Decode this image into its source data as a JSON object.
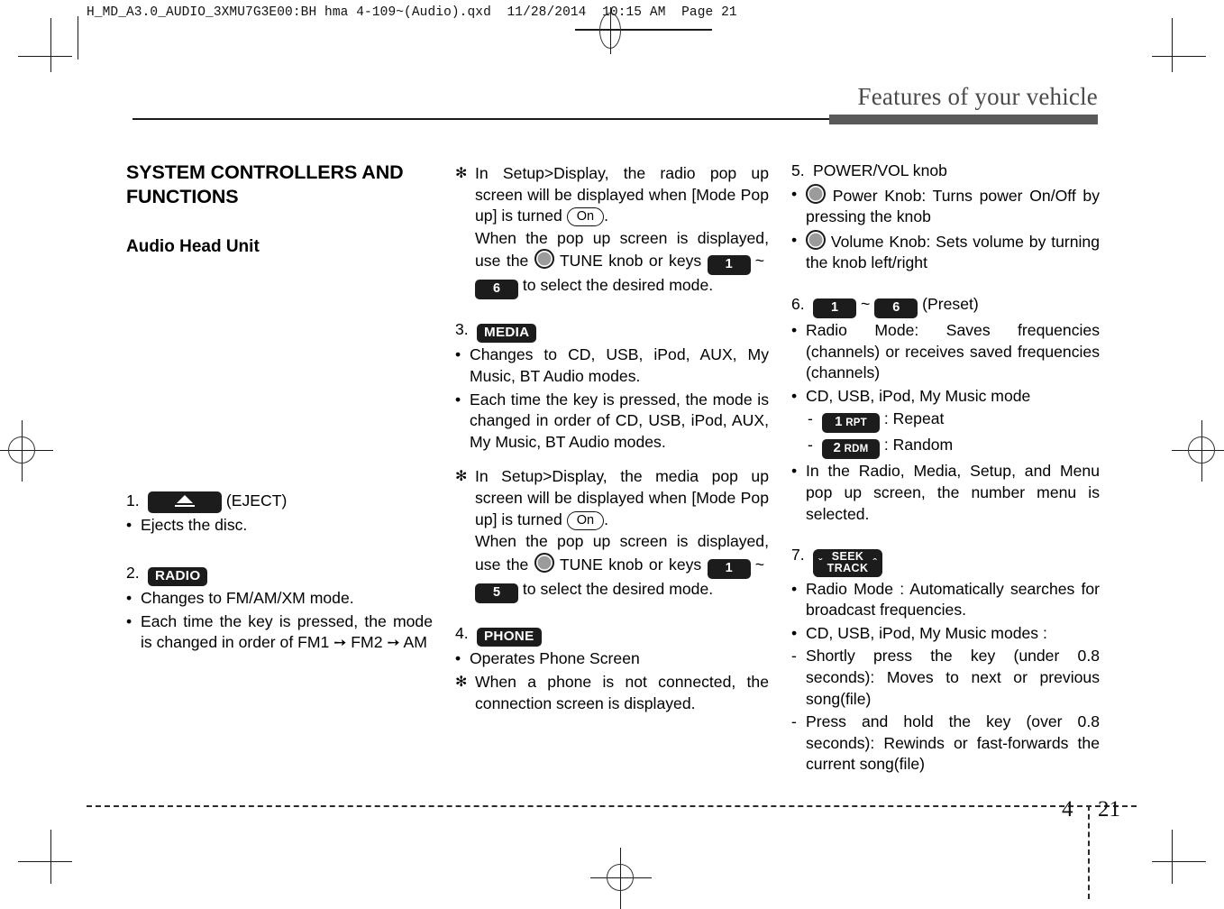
{
  "prepress": {
    "slug": "H_MD_A3.0_AUDIO_3XMU7G3E00:BH hma 4-109~(Audio).qxd  11/28/2014  10:15 AM  Page 21"
  },
  "running_head": "Features of your vehicle",
  "footer": {
    "chapter": "4",
    "page": "21"
  },
  "columns": {
    "left": {
      "section_title": "SYSTEM CONTROLLERS AND FUNCTIONS",
      "subsection_title": "Audio Head Unit",
      "item1": {
        "number": "1.",
        "key_label": "eject-glyph",
        "caption": "(EJECT)",
        "bullets": [
          {
            "marker": "•",
            "text": "Ejects the disc."
          }
        ]
      },
      "item2": {
        "number": "2.",
        "key_label": "RADIO",
        "bullets": [
          {
            "marker": "•",
            "text": "Changes to FM/AM/XM mode."
          },
          {
            "marker": "•",
            "text_a": "Each time the key is pressed, the mode is changed in order of FM1 ",
            "arrow1": "➙",
            "text_b": " FM2 ",
            "arrow2": "➙",
            "text_c": " AM"
          }
        ]
      }
    },
    "middle": {
      "note1": {
        "marker": "✻",
        "line_a": "In Setup>Display, the radio pop up screen will be displayed when [Mode Pop up] is turned ",
        "on_label": "On",
        "line_a_end": ".",
        "line_b_1": "When the pop up screen is displayed, use the ",
        "line_b_2": " TUNE knob or keys ",
        "key_from": "1",
        "tilde": "~",
        "key_to": "6",
        "line_b_3": " to select the desired mode."
      },
      "item3": {
        "number": "3.",
        "key_label": "MEDIA",
        "bullets": [
          {
            "marker": "•",
            "text": "Changes to CD, USB, iPod, AUX, My Music, BT Audio modes."
          },
          {
            "marker": "•",
            "text": "Each time the key is pressed, the mode is changed in order of CD, USB, iPod, AUX, My Music, BT Audio modes."
          }
        ]
      },
      "note2": {
        "marker": "✻",
        "line_a": "In Setup>Display, the media pop up screen will be displayed when [Mode Pop up] is turned ",
        "on_label": "On",
        "line_a_end": ".",
        "line_b_1": "When the pop up screen is displayed, use the ",
        "line_b_2": " TUNE knob or keys ",
        "key_from": "1",
        "tilde": "~",
        "key_to": "5",
        "line_b_3": " to select the desired mode."
      },
      "item4": {
        "number": "4.",
        "key_label": "PHONE",
        "bullets": [
          {
            "marker": "•",
            "text": "Operates Phone Screen"
          }
        ],
        "note": {
          "marker": "✻",
          "text": "When a phone is not connected, the connection screen is displayed."
        }
      }
    },
    "right": {
      "item5": {
        "number": "5.",
        "title": "POWER/VOL knob",
        "bullets": [
          {
            "marker": "•",
            "icon": "knob-icon",
            "text": "Power Knob: Turns power On/Off by pressing the knob"
          },
          {
            "marker": "•",
            "icon": "knob-icon",
            "text": "Volume Knob: Sets volume by turning the knob left/right"
          }
        ]
      },
      "item6": {
        "number": "6.",
        "key_from": "1",
        "tilde": "~",
        "key_to": "6",
        "caption": "(Preset)",
        "bullets": [
          {
            "marker": "•",
            "text": "Radio Mode: Saves frequencies (channels) or receives saved frequencies (channels)"
          },
          {
            "marker": "•",
            "text": "CD, USB, iPod, My Music mode"
          }
        ],
        "sub_items": [
          {
            "dash": "-",
            "key_num": "1",
            "key_fn": "RPT",
            "text": ": Repeat"
          },
          {
            "dash": "-",
            "key_num": "2",
            "key_fn": "RDM",
            "text": ": Random"
          }
        ],
        "bullet_last": {
          "marker": "•",
          "text": "In the Radio, Media, Setup, and Menu pop up screen, the number menu is selected."
        }
      },
      "item7": {
        "number": "7.",
        "key_seek": {
          "left_chevron": "ˇ",
          "line1": "SEEK",
          "line2": "TRACK",
          "right_chevron": "ˆ"
        },
        "bullets": [
          {
            "marker": "•",
            "text": "Radio Mode : Automatically searches for broadcast frequencies."
          },
          {
            "marker": "•",
            "text": "CD, USB, iPod, My Music modes :"
          }
        ],
        "sub_items": [
          {
            "dash": "-",
            "text": "Shortly press the key (under 0.8 seconds): Moves to next or previous song(file)"
          },
          {
            "dash": "-",
            "text": "Press and hold the key (over 0.8 seconds): Rewinds or fast-forwards the current song(file)"
          }
        ]
      }
    }
  },
  "colors": {
    "key_badge_bg": "#1c1c1c",
    "head_bar": "#595959",
    "running_head_text": "#4a4a4a"
  }
}
